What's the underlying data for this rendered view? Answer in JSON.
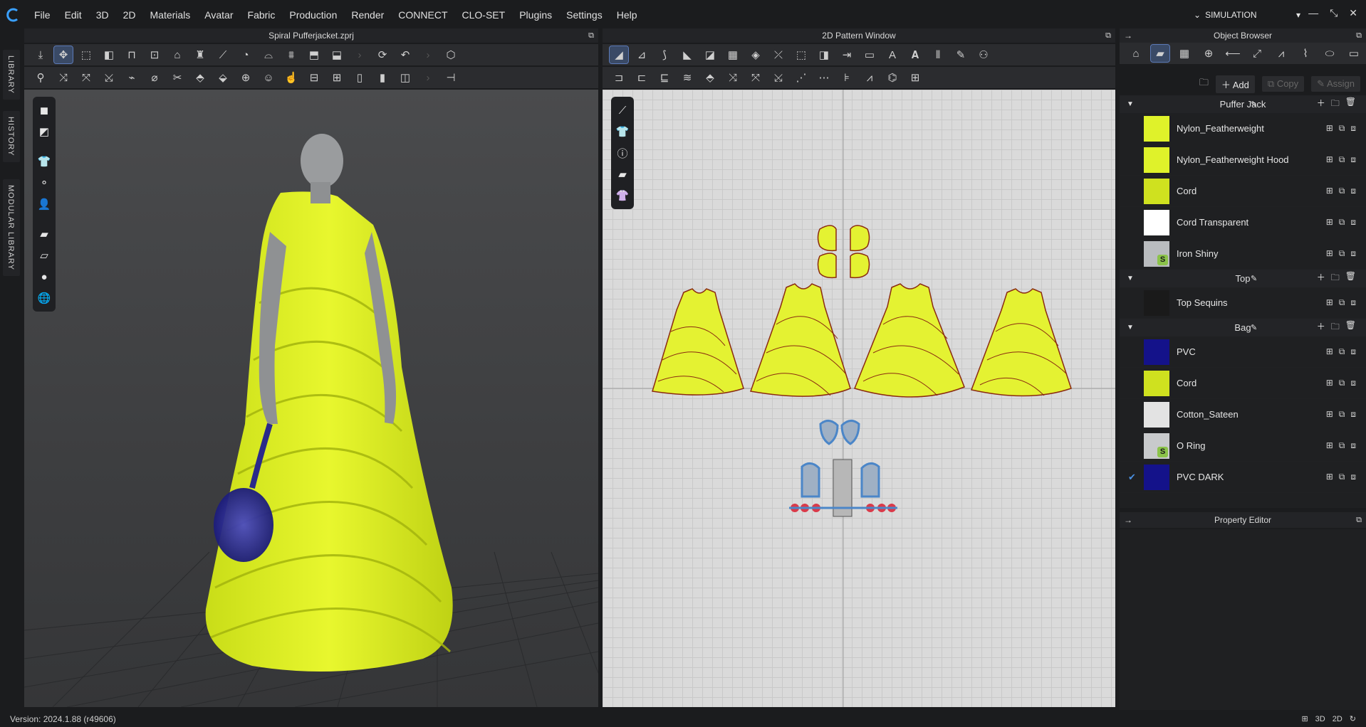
{
  "menu": [
    "File",
    "Edit",
    "3D",
    "2D",
    "Materials",
    "Avatar",
    "Fabric",
    "Production",
    "Render",
    "CONNECT",
    "CLO-SET",
    "Plugins",
    "Settings",
    "Help"
  ],
  "mode": "SIMULATION",
  "left_tabs": [
    "LIBRARY",
    "HISTORY",
    "MODULAR LIBRARY"
  ],
  "panels": {
    "view3d_title": "Spiral Pufferjacket.zprj",
    "pattern_title": "2D Pattern Window",
    "browser_title": "Object Browser",
    "property_title": "Property Editor"
  },
  "browser_actions": {
    "add": "Add",
    "copy": "Copy",
    "assign": "Assign"
  },
  "groups": [
    {
      "name": "Puffer Jack",
      "items": [
        {
          "label": "Nylon_Featherweight",
          "color": "#dff22a",
          "badge": ""
        },
        {
          "label": "Nylon_Featherweight Hood",
          "color": "#dff22a",
          "badge": ""
        },
        {
          "label": "Cord",
          "color": "#cfe11f",
          "badge": ""
        },
        {
          "label": "Cord Transparent",
          "color": "#ffffff",
          "badge": ""
        },
        {
          "label": "Iron Shiny",
          "color": "#b9bcbf",
          "badge": "S"
        }
      ]
    },
    {
      "name": "Top",
      "items": [
        {
          "label": "Top Sequins",
          "color": "#1a1a1a",
          "badge": ""
        }
      ]
    },
    {
      "name": "Bag",
      "items": [
        {
          "label": "PVC",
          "color": "#14128a",
          "badge": ""
        },
        {
          "label": "Cord",
          "color": "#cfe11f",
          "badge": ""
        },
        {
          "label": "Cotton_Sateen",
          "color": "#e3e3e3",
          "badge": ""
        },
        {
          "label": "O Ring",
          "color": "#c8cacc",
          "badge": "S"
        },
        {
          "label": "PVC DARK",
          "color": "#14128a",
          "badge": ""
        }
      ]
    }
  ],
  "status": "Version: 2024.1.88 (r49606)"
}
